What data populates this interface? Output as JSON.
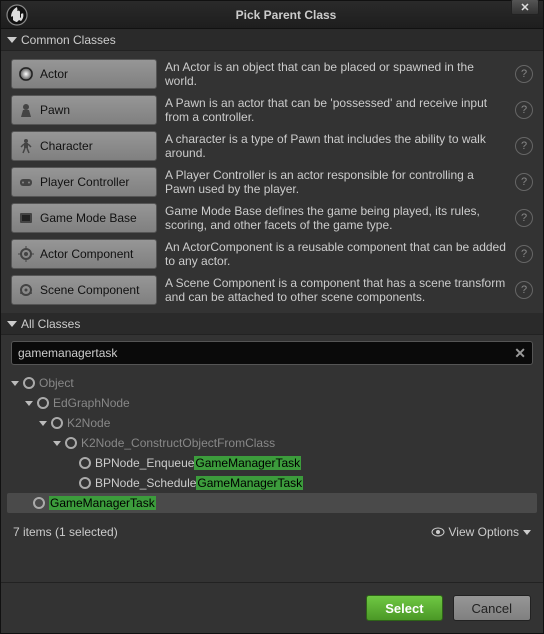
{
  "title": "Pick Parent Class",
  "sections": {
    "common": "Common Classes",
    "all": "All Classes"
  },
  "classes": [
    {
      "label": "Actor",
      "desc": "An Actor is an object that can be placed or spawned in the world."
    },
    {
      "label": "Pawn",
      "desc": "A Pawn is an actor that can be 'possessed' and receive input from a controller."
    },
    {
      "label": "Character",
      "desc": "A character is a type of Pawn that includes the ability to walk around."
    },
    {
      "label": "Player Controller",
      "desc": "A Player Controller is an actor responsible for controlling a Pawn used by the player."
    },
    {
      "label": "Game Mode Base",
      "desc": "Game Mode Base defines the game being played, its rules, scoring, and other facets of the game type."
    },
    {
      "label": "Actor Component",
      "desc": "An ActorComponent is a reusable component that can be added to any actor."
    },
    {
      "label": "Scene Component",
      "desc": "A Scene Component is a component that has a scene transform and can be attached to other scene components."
    }
  ],
  "search": {
    "value": "gamemanagertask"
  },
  "tree": {
    "n0": "Object",
    "n1": "EdGraphNode",
    "n2": "K2Node",
    "n3": "K2Node_ConstructObjectFromClass",
    "n4a": "BPNode_Enqueue",
    "n4b": "GameManagerTask",
    "n5a": "BPNode_Schedule",
    "n5b": "GameManagerTask",
    "n6": "GameManagerTask"
  },
  "status": "7 items (1 selected)",
  "viewopts": "View Options",
  "buttons": {
    "select": "Select",
    "cancel": "Cancel"
  }
}
